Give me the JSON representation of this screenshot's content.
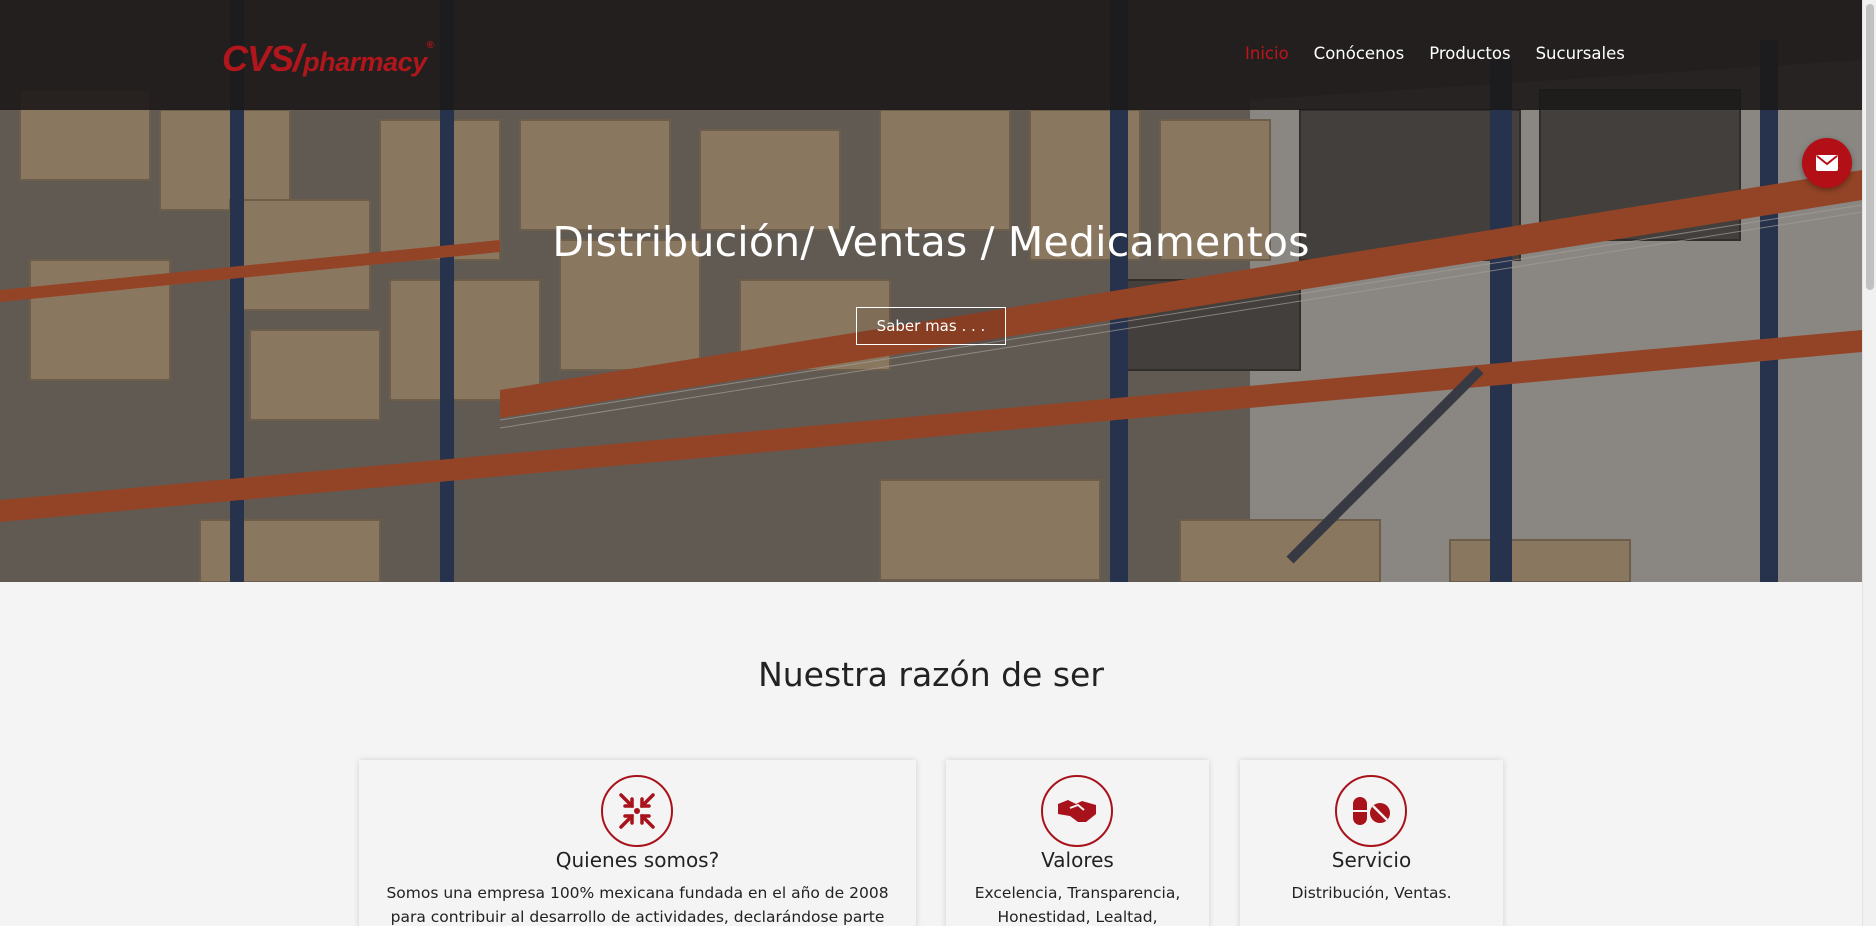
{
  "brand": {
    "logo_part1": "CVS",
    "logo_slash": "/",
    "logo_part2": "pharmacy",
    "logo_reg": "®",
    "color": "#b0161b"
  },
  "nav": {
    "items": [
      {
        "label": "Inicio",
        "active": true
      },
      {
        "label": "Conócenos",
        "active": false
      },
      {
        "label": "Productos",
        "active": false
      },
      {
        "label": "Sucursales",
        "active": false
      }
    ]
  },
  "hero": {
    "title": "Distribución/ Ventas / Medicamentos",
    "button_label": "Saber mas . . ."
  },
  "fab": {
    "icon": "envelope-icon",
    "color": "#b30f16"
  },
  "section": {
    "title": "Nuestra razón de ser",
    "cards": [
      {
        "icon": "compress-arrows-icon",
        "title": "Quienes somos?",
        "text": "Somos una empresa 100% mexicana fundada en el año de 2008 para contribuir al desarrollo de actividades, declarándose parte"
      },
      {
        "icon": "handshake-icon",
        "title": "Valores",
        "text": "Excelencia, Transparencia, Honestidad, Lealtad,"
      },
      {
        "icon": "pills-icon",
        "title": "Servicio",
        "text": "Distribución, Ventas."
      }
    ]
  },
  "accent_color": "#a8121a"
}
